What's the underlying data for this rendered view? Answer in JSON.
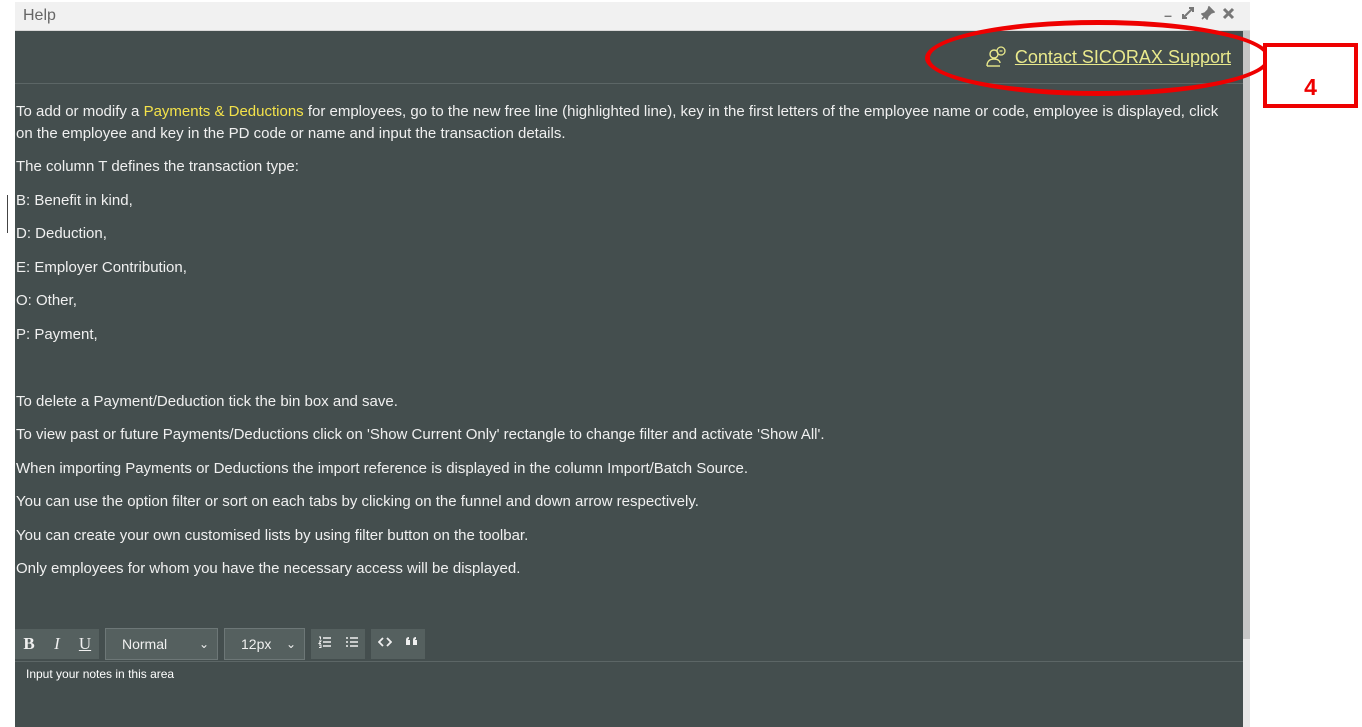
{
  "window": {
    "title": "Help",
    "controls": [
      "minimize-icon",
      "expand-icon",
      "pin-icon",
      "close-icon"
    ]
  },
  "support": {
    "link_label": "Contact SICORAX Support",
    "icon": "support-agent-icon",
    "link_color": "#e9e98c"
  },
  "help": {
    "intro": {
      "before": "To add or modify a ",
      "highlight": "Payments & Deductions",
      "after": " for employees, go to the new free line (highlighted line), key in the first letters of the employee name or code, employee is displayed, click on the employee and key in the PD code or name and input the transaction details."
    },
    "type_heading": "The column T defines the transaction type:",
    "types": [
      "B: Benefit in kind,",
      "D: Deduction,",
      "E: Employer Contribution,",
      "O: Other,",
      "P: Payment,"
    ],
    "notes": [
      "To delete a Payment/Deduction tick the bin box and save.",
      "To view past or future Payments/Deductions click on 'Show Current Only' rectangle to change filter and activate 'Show All'.",
      "When importing Payments or Deductions the import reference is displayed in the column Import/Batch Source.",
      "You can use the option filter or sort on each tabs by clicking on the funnel and down arrow respectively.",
      "You can create your own customised lists by using filter button on the toolbar.",
      "Only employees for whom you have the necessary access will be displayed."
    ],
    "highlight_color": "#f4e24a"
  },
  "editor": {
    "bold": "B",
    "italic": "I",
    "underline": "U",
    "format_value": "Normal",
    "size_value": "12px",
    "placeholder": "Input your notes in this area"
  },
  "annotation": {
    "callout_number": "4",
    "color": "#ee0000"
  }
}
